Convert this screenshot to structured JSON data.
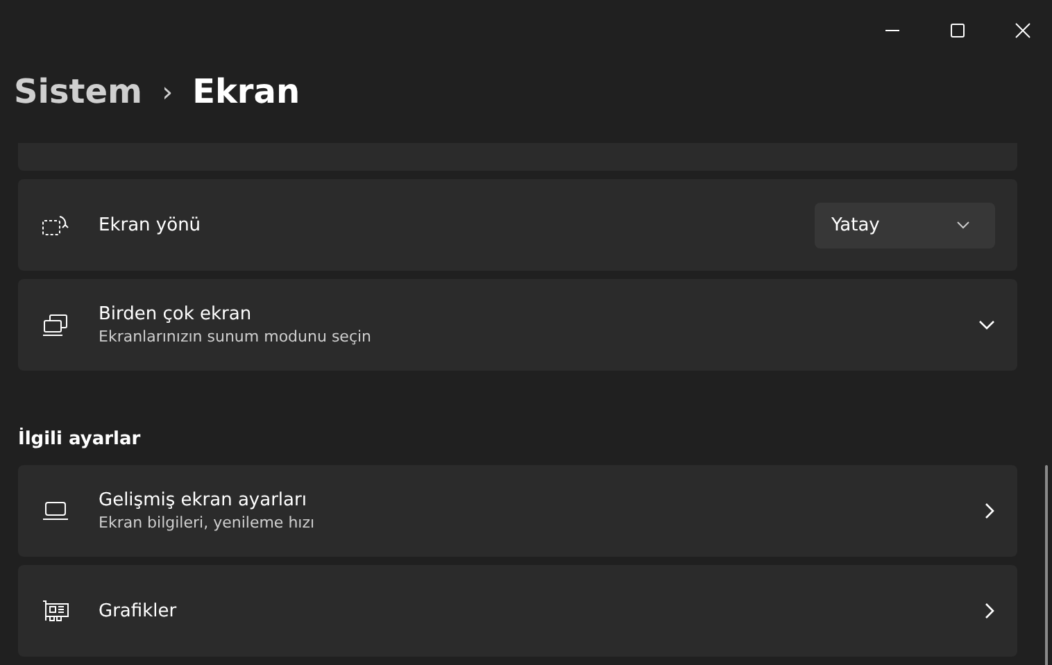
{
  "breadcrumb": {
    "parent": "Sistem",
    "separator": "›",
    "current": "Ekran"
  },
  "rows": [
    {
      "kind": "dropdown",
      "title": "Ekran yönü",
      "value": "Yatay"
    },
    {
      "kind": "expand",
      "title": "Birden çok ekran",
      "subtitle": "Ekranlarınızın sunum modunu seçin",
      "expanded": false
    }
  ],
  "related": {
    "heading": "İlgili ayarlar",
    "rows": [
      {
        "kind": "link",
        "title": "Gelişmiş ekran ayarları",
        "subtitle": "Ekran bilgileri, yenileme hızı"
      },
      {
        "kind": "link",
        "title": "Grafikler"
      }
    ]
  }
}
